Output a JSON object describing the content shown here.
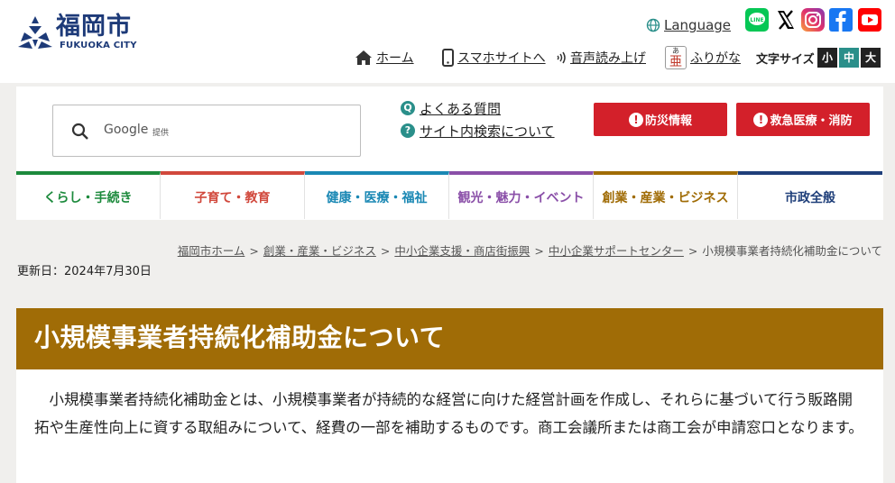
{
  "header": {
    "logo_name": "福岡市",
    "logo_sub": "FUKUOKA CITY",
    "language": "Language",
    "sns": [
      {
        "name": "LINE",
        "color": "#06c755"
      },
      {
        "name": "X",
        "color": "#000000"
      },
      {
        "name": "Instagram",
        "color": "#e1306c"
      },
      {
        "name": "Facebook",
        "color": "#1877f2"
      },
      {
        "name": "YouTube",
        "color": "#ff0000"
      }
    ],
    "util": {
      "home": "ホーム",
      "smartphone": "スマホサイトへ",
      "reader": "音声読み上げ",
      "furigana": "ふりがな",
      "furigana_icon_char": "亜",
      "furigana_icon_ruby": "あ",
      "font_size_label": "文字サイズ",
      "font_small": "小",
      "font_medium": "中",
      "font_large": "大"
    }
  },
  "search": {
    "provider": "Google",
    "provided_by": "提供",
    "faq": "よくある質問",
    "faq_icon": "Q",
    "about_search": "サイト内検索について",
    "about_icon": "?"
  },
  "emergency": {
    "disaster": "防災情報",
    "medical": "救急医療・消防",
    "color": "#d3202a"
  },
  "gnav": [
    {
      "label": "くらし・手続き",
      "color": "#1c8a3c"
    },
    {
      "label": "子育て・教育",
      "color": "#d1483c"
    },
    {
      "label": "健康・医療・福祉",
      "color": "#1a88b4"
    },
    {
      "label": "観光・魅力・イベント",
      "color": "#8a4fa8"
    },
    {
      "label": "創業・産業・ビジネス",
      "color": "#a06c06"
    },
    {
      "label": "市政全般",
      "color": "#1f3f7a"
    }
  ],
  "breadcrumb": {
    "items": [
      "福岡市ホーム",
      "創業・産業・ビジネス",
      "中小企業支援・商店街振興",
      "中小企業サポートセンター"
    ],
    "separator": ">",
    "current": "小規模事業者持続化補助金について"
  },
  "updated": "更新日：2024年7月30日",
  "page": {
    "title": "小規模事業者持続化補助金について",
    "body": "小規模事業者持続化補助金とは、小規模事業者が持続的な経営に向けた経営計画を作成し、それらに基づいて行う販路開拓や生産性向上に資する取組みについて、経費の一部を補助するものです。商工会議所または商工会が申請窓口となります。"
  }
}
